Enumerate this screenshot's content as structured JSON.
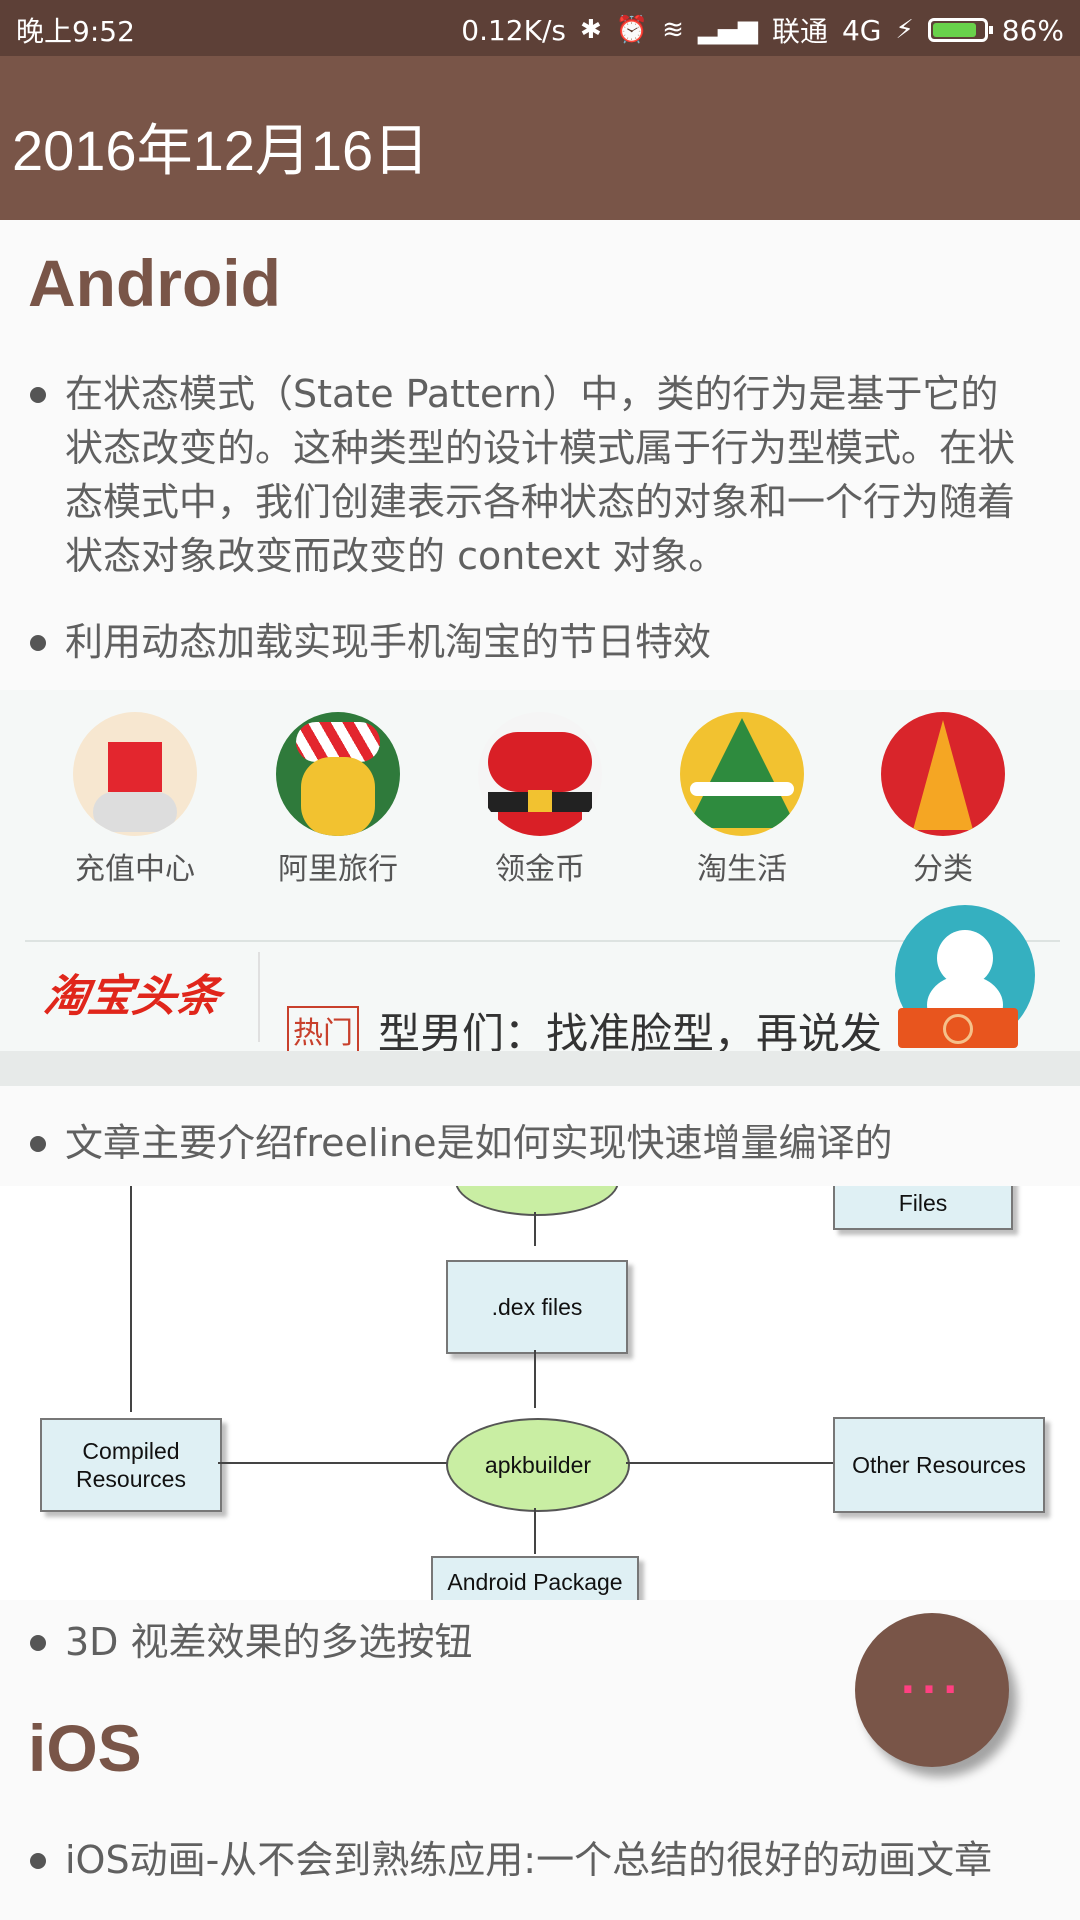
{
  "status_bar": {
    "time": "晚上9:52",
    "speed": "0.12K/s",
    "carrier": "联通",
    "network": "4G",
    "battery": "86%",
    "battery_level": 0.86,
    "icons": [
      "bluetooth-icon",
      "alarm-icon",
      "wifi-icon",
      "signal-icon",
      "charging-icon",
      "battery-icon"
    ]
  },
  "app_bar": {
    "title": "2016年12月16日"
  },
  "sections": {
    "android": {
      "heading": "Android",
      "items": [
        "在状态模式（State Pattern）中，类的行为是基于它的状态改变的。这种类型的设计模式属于行为型模式。在状态模式中，我们创建表示各种状态的对象和一个行为随着状态对象改变而改变的 context 对象。",
        "利用动态加载实现手机淘宝的节日特效",
        "文章主要介绍freeline是如何实现快速增量编译的",
        "3D 视差效果的多选按钮"
      ]
    },
    "ios": {
      "heading": "iOS",
      "items": [
        "iOS动画-从不会到熟练应用:一个总结的很好的动画文章"
      ]
    }
  },
  "taobao_image": {
    "icons": [
      {
        "label": "充值中心",
        "color": "#e3262e"
      },
      {
        "label": "阿里旅行",
        "color": "#f2c230"
      },
      {
        "label": "领金币",
        "color": "#d91f26"
      },
      {
        "label": "淘生活",
        "color": "#2e8b3e"
      },
      {
        "label": "分类",
        "color": "#d9252b"
      }
    ],
    "brand": "淘宝头条",
    "hot_tag": "热门",
    "headline": "型男们：找准脸型，再说发"
  },
  "freeline_diagram": {
    "dex_files": ".dex files",
    "files": "Files",
    "compiled_resources": "Compiled Resources",
    "apkbuilder": "apkbuilder",
    "other_resources": "Other Resources",
    "android_package": "Android Package"
  },
  "fab": {
    "label": "···",
    "icon": "more-icon"
  },
  "colors": {
    "primary": "#795548",
    "primary_dark": "#5d4037",
    "accent": "#ff4081"
  }
}
